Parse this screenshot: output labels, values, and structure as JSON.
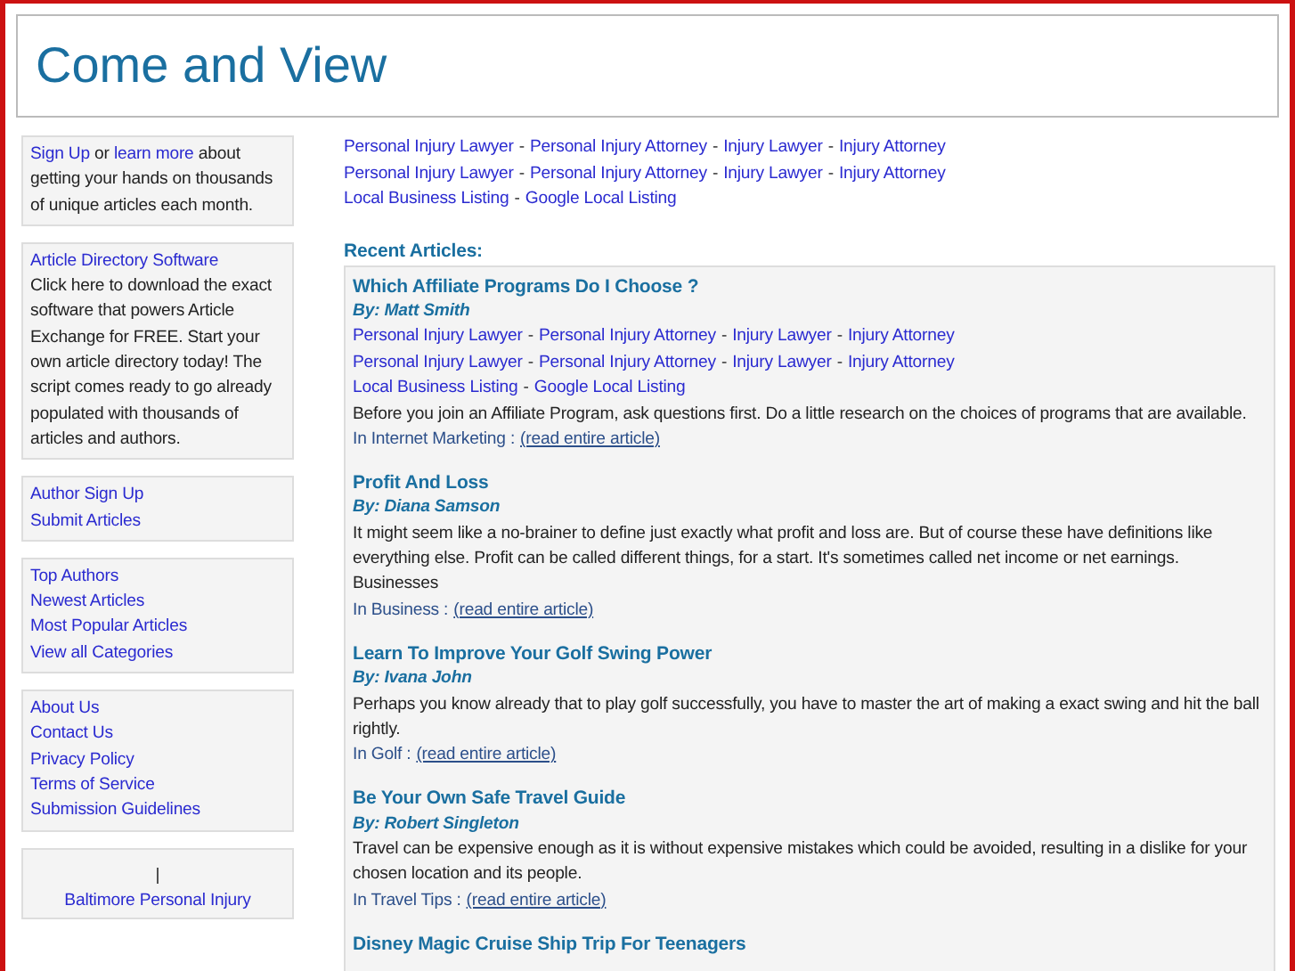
{
  "header": {
    "title": "Come and View"
  },
  "sidebar": {
    "boxes": [
      {
        "kind": "paragraph",
        "segments": [
          {
            "text": "Sign Up",
            "link": true
          },
          {
            "text": "or",
            "link": false
          },
          {
            "text": "learn more",
            "link": true
          },
          {
            "text": "about getting your hands on thousands of unique articles each month.",
            "link": false
          }
        ]
      },
      {
        "kind": "promo",
        "title": "Article Directory Software",
        "body": "Click here to download the exact software that powers Article Exchange for FREE. Start your own article directory today! The script comes ready to go already populated with thousands of articles and authors."
      },
      {
        "kind": "links",
        "items": [
          "Author Sign Up",
          "Submit Articles"
        ]
      },
      {
        "kind": "links",
        "items": [
          "Top Authors",
          "Newest Articles",
          "Most Popular Articles",
          "View all Categories"
        ]
      },
      {
        "kind": "links",
        "items": [
          "About Us",
          "Contact Us",
          "Privacy Policy",
          "Terms of Service",
          "Submission Guidelines"
        ]
      },
      {
        "kind": "centered",
        "separator": "|",
        "items": [
          "Baltimore Personal Injury"
        ]
      }
    ]
  },
  "link_rows": [
    [
      {
        "kind": "link",
        "text": "Personal Injury Lawyer"
      },
      {
        "kind": "sep",
        "text": "-"
      },
      {
        "kind": "link",
        "text": "Personal Injury Attorney"
      },
      {
        "kind": "sep",
        "text": "-"
      },
      {
        "kind": "link",
        "text": "Injury Lawyer"
      },
      {
        "kind": "sep",
        "text": "-"
      },
      {
        "kind": "link",
        "text": "Injury Attorney"
      }
    ],
    [
      {
        "kind": "link",
        "text": "Personal Injury Lawyer"
      },
      {
        "kind": "sep",
        "text": "-"
      },
      {
        "kind": "link",
        "text": "Personal Injury Attorney"
      },
      {
        "kind": "sep",
        "text": "-"
      },
      {
        "kind": "link",
        "text": "Injury Lawyer"
      },
      {
        "kind": "sep",
        "text": "-"
      },
      {
        "kind": "link",
        "text": "Injury Attorney"
      }
    ],
    [
      {
        "kind": "link",
        "text": "Local Business Listing"
      },
      {
        "kind": "sep",
        "text": "-"
      },
      {
        "kind": "link",
        "text": "Google Local Listing"
      }
    ]
  ],
  "recent": {
    "heading": "Recent Articles:",
    "articles": [
      {
        "title": "Which Affiliate Programs Do I Choose ?",
        "author": "By: Matt Smith",
        "link_rows": [
          [
            {
              "kind": "link",
              "text": "Personal Injury Lawyer"
            },
            {
              "kind": "sep",
              "text": "-"
            },
            {
              "kind": "link",
              "text": "Personal Injury Attorney"
            },
            {
              "kind": "sep",
              "text": "-"
            },
            {
              "kind": "link",
              "text": "Injury Lawyer"
            },
            {
              "kind": "sep",
              "text": "-"
            },
            {
              "kind": "link",
              "text": "Injury Attorney"
            }
          ],
          [
            {
              "kind": "link",
              "text": "Personal Injury Lawyer"
            },
            {
              "kind": "sep",
              "text": "-"
            },
            {
              "kind": "link",
              "text": "Personal Injury Attorney"
            },
            {
              "kind": "sep",
              "text": "-"
            },
            {
              "kind": "link",
              "text": "Injury Lawyer"
            },
            {
              "kind": "sep",
              "text": "-"
            },
            {
              "kind": "link",
              "text": "Injury Attorney"
            }
          ],
          [
            {
              "kind": "link",
              "text": "Local Business Listing"
            },
            {
              "kind": "sep",
              "text": "-"
            },
            {
              "kind": "link",
              "text": "Google Local Listing"
            }
          ]
        ],
        "summary": "Before you join an Affiliate Program, ask questions first. Do a little research on the choices of programs that are available.",
        "category": "In Internet Marketing :",
        "read_more": "(read entire article)"
      },
      {
        "title": "Profit And Loss",
        "author": "By: Diana Samson",
        "summary": "It might seem like a no-brainer to define just exactly what profit and loss are. But of course these have definitions like everything else. Profit can be called different things, for a start. It's sometimes called net income or net earnings. Businesses",
        "category": "In Business :",
        "read_more": "(read entire article)"
      },
      {
        "title": "Learn To Improve Your Golf Swing Power",
        "author": "By: Ivana John",
        "summary": "Perhaps you know already that to play golf successfully, you have to master the art of making a exact swing and hit the ball rightly.",
        "category": "In Golf :",
        "read_more": "(read entire article)"
      },
      {
        "title": "Be Your Own Safe Travel Guide",
        "author": "By: Robert Singleton",
        "summary": "Travel can be expensive enough as it is without expensive mistakes which could be avoided, resulting in a dislike for your chosen location and its people.",
        "category": "In Travel Tips :",
        "read_more": "(read entire article)"
      },
      {
        "title": "Disney Magic Cruise Ship Trip For Teenagers"
      }
    ]
  }
}
